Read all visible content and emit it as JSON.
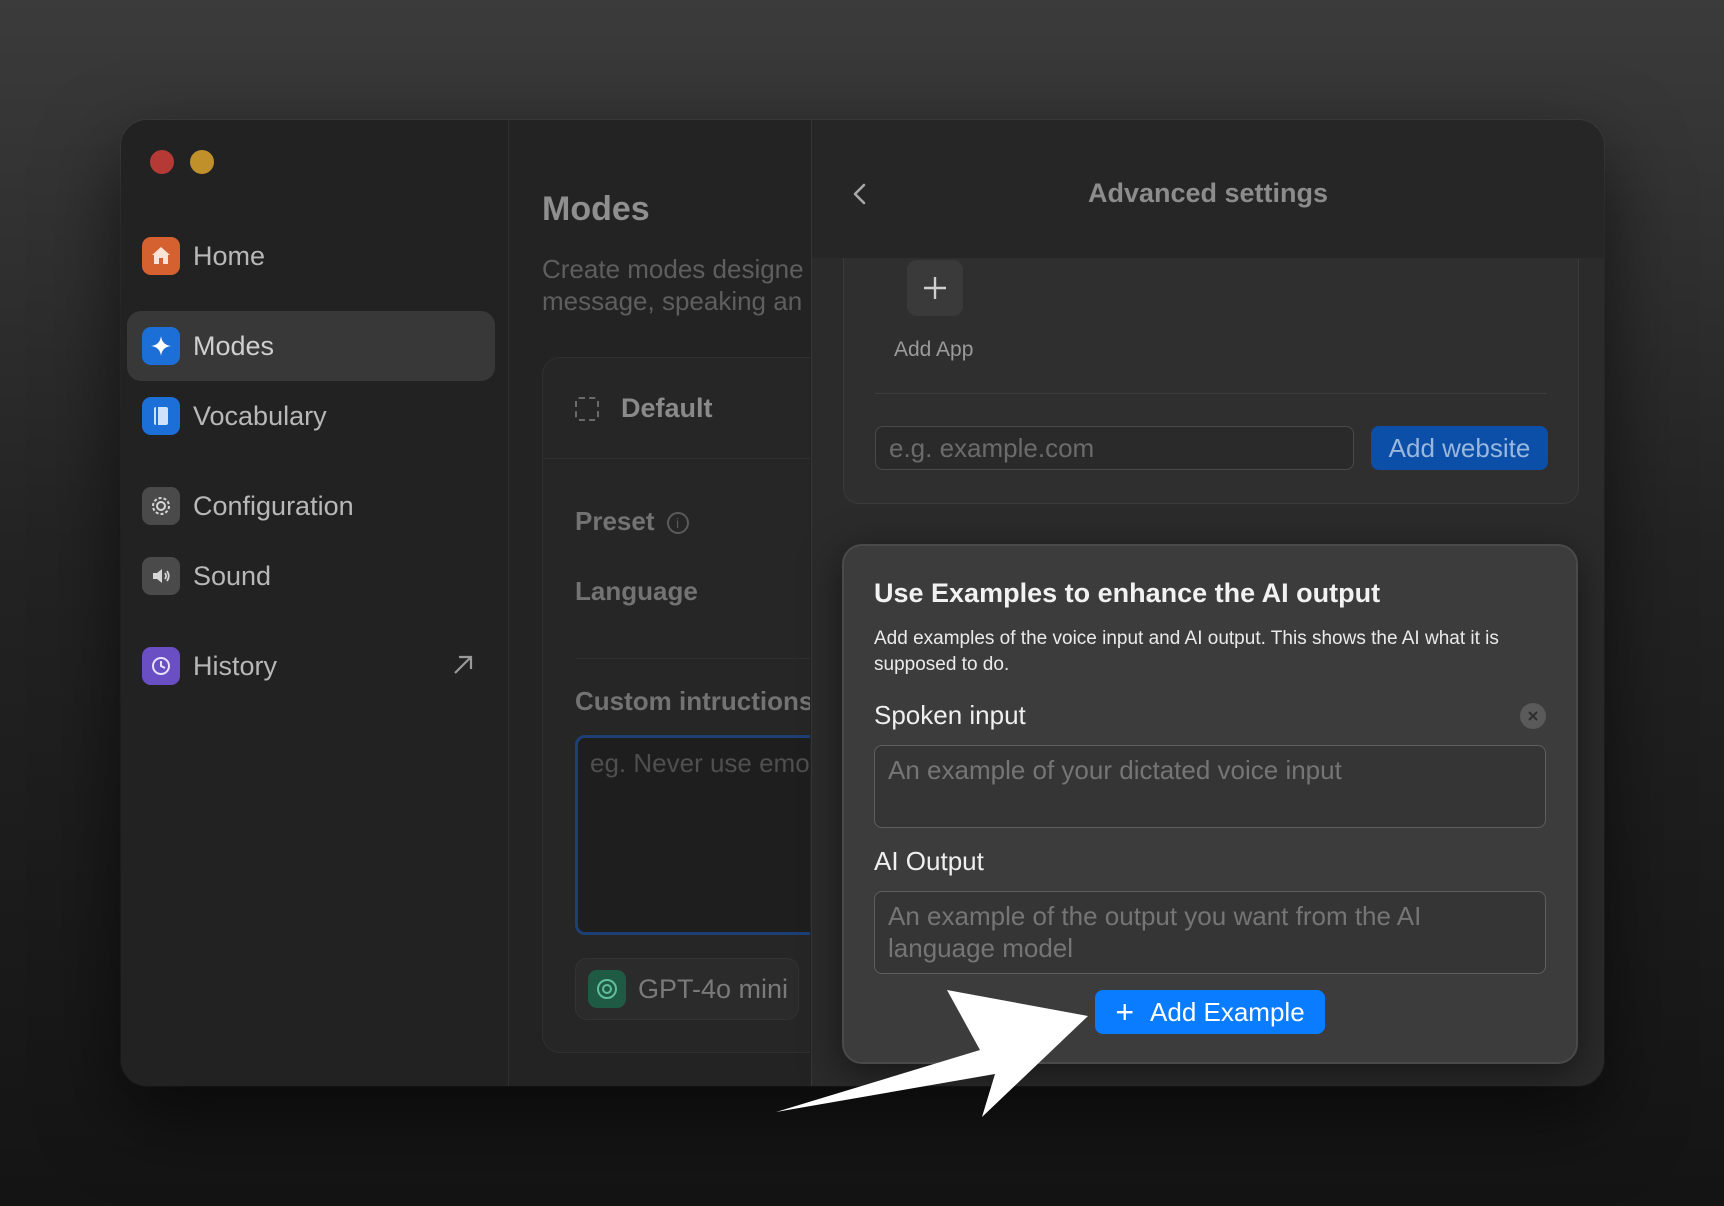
{
  "sidebar": {
    "items": [
      {
        "label": "Home",
        "icon": "house-icon",
        "color": "#d4612f"
      },
      {
        "label": "Modes",
        "icon": "sparkle-icon",
        "color": "#1d6fd8"
      },
      {
        "label": "Vocabulary",
        "icon": "book-icon",
        "color": "#1d6fd8"
      },
      {
        "label": "Configuration",
        "icon": "gear-icon",
        "color": "#5a5a5a"
      },
      {
        "label": "Sound",
        "icon": "speaker-icon",
        "color": "#5a5a5a"
      },
      {
        "label": "History",
        "icon": "history-icon",
        "color": "#6a4fc4"
      }
    ]
  },
  "modes": {
    "title": "Modes",
    "description_line1": "Create modes designe",
    "description_line2": "message, speaking an",
    "mode_name": "Default",
    "preset_label": "Preset",
    "language_label": "Language",
    "custom_instructions_label": "Custom intructions",
    "custom_instructions_placeholder": "eg. Never use emo",
    "model_name": "GPT-4o mini"
  },
  "advanced": {
    "title": "Advanced settings",
    "add_app_label": "Add App",
    "website_placeholder": "e.g. example.com",
    "add_website_label": "Add website"
  },
  "examples": {
    "title": "Use Examples to enhance the AI output",
    "description": "Add examples of the voice input and AI output. This shows the AI what it is supposed to do.",
    "spoken_input_label": "Spoken input",
    "spoken_input_placeholder": "An example of your dictated voice input",
    "ai_output_label": "AI Output",
    "ai_output_placeholder": "An example of the output you want from the AI language model",
    "add_example_label": "Add Example"
  },
  "colors": {
    "accent": "#0a7cff",
    "accent_dim": "#0b4fa8"
  }
}
